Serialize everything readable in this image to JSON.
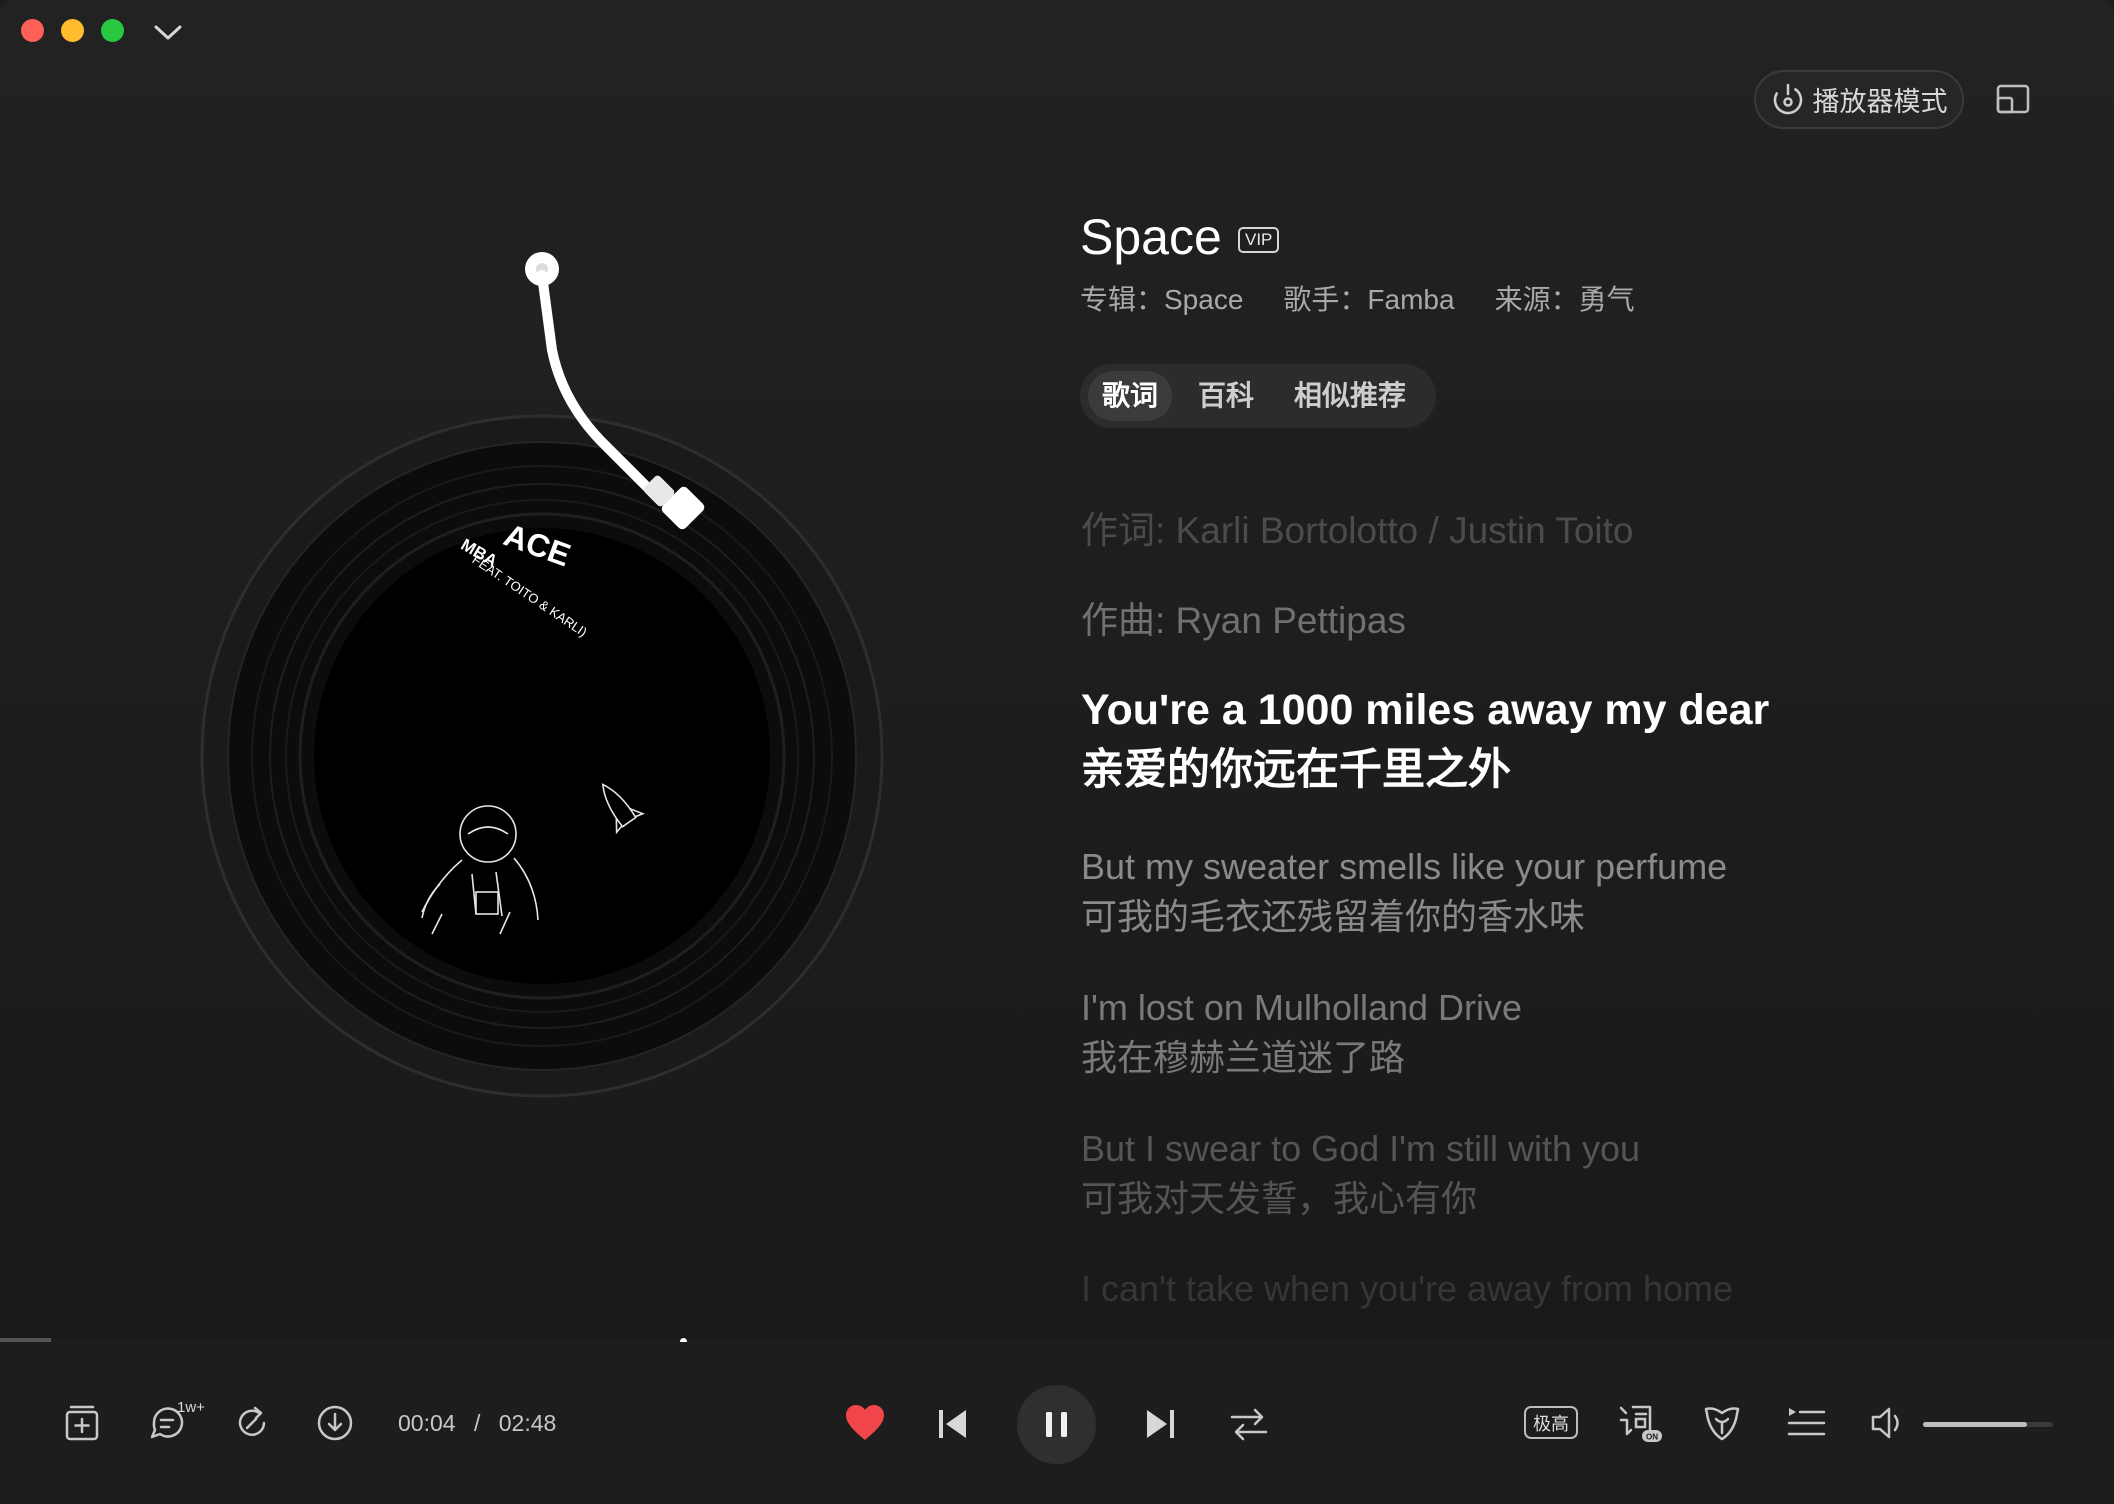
{
  "header": {
    "player_mode_label": "播放器模式"
  },
  "song": {
    "title": "Space",
    "vip_badge": "VIP",
    "album_label": "专辑：Space",
    "artist_label": "歌手：Famba",
    "source_label": "来源：勇气"
  },
  "record": {
    "label_text_1": "ACE",
    "label_text_2": "MBA",
    "label_text_3": "FEAT. TOITO & KARLI)"
  },
  "tabs": [
    {
      "label": "歌词",
      "active": true
    },
    {
      "label": "百科",
      "active": false
    },
    {
      "label": "相似推荐",
      "active": false
    }
  ],
  "lyrics": {
    "lyricist": "作词: Karli Bortolotto / Justin Toito",
    "composer": "作曲: Ryan Pettipas",
    "current_en": "You're a 1000 miles away my dear",
    "current_zh": "亲爱的你远在千里之外",
    "line2_en": "But my sweater smells like your perfume",
    "line2_zh": "可我的毛衣还残留着你的香水味",
    "line3_en": "I'm lost on Mulholland Drive",
    "line3_zh": "我在穆赫兰道迷了路",
    "line4_en": "But I swear to God I'm still with you",
    "line4_zh": "可我对天发誓，我心有你",
    "line5_en": "I can't take when you're away from home"
  },
  "player": {
    "comment_count": "1w+",
    "current_time": "00:04",
    "separator": "/",
    "duration": "02:48",
    "quality_label": "极高",
    "progress": 0.024,
    "volume": 0.8
  },
  "colors": {
    "accent_heart": "#f0454a",
    "background": "#1b1b1b"
  }
}
